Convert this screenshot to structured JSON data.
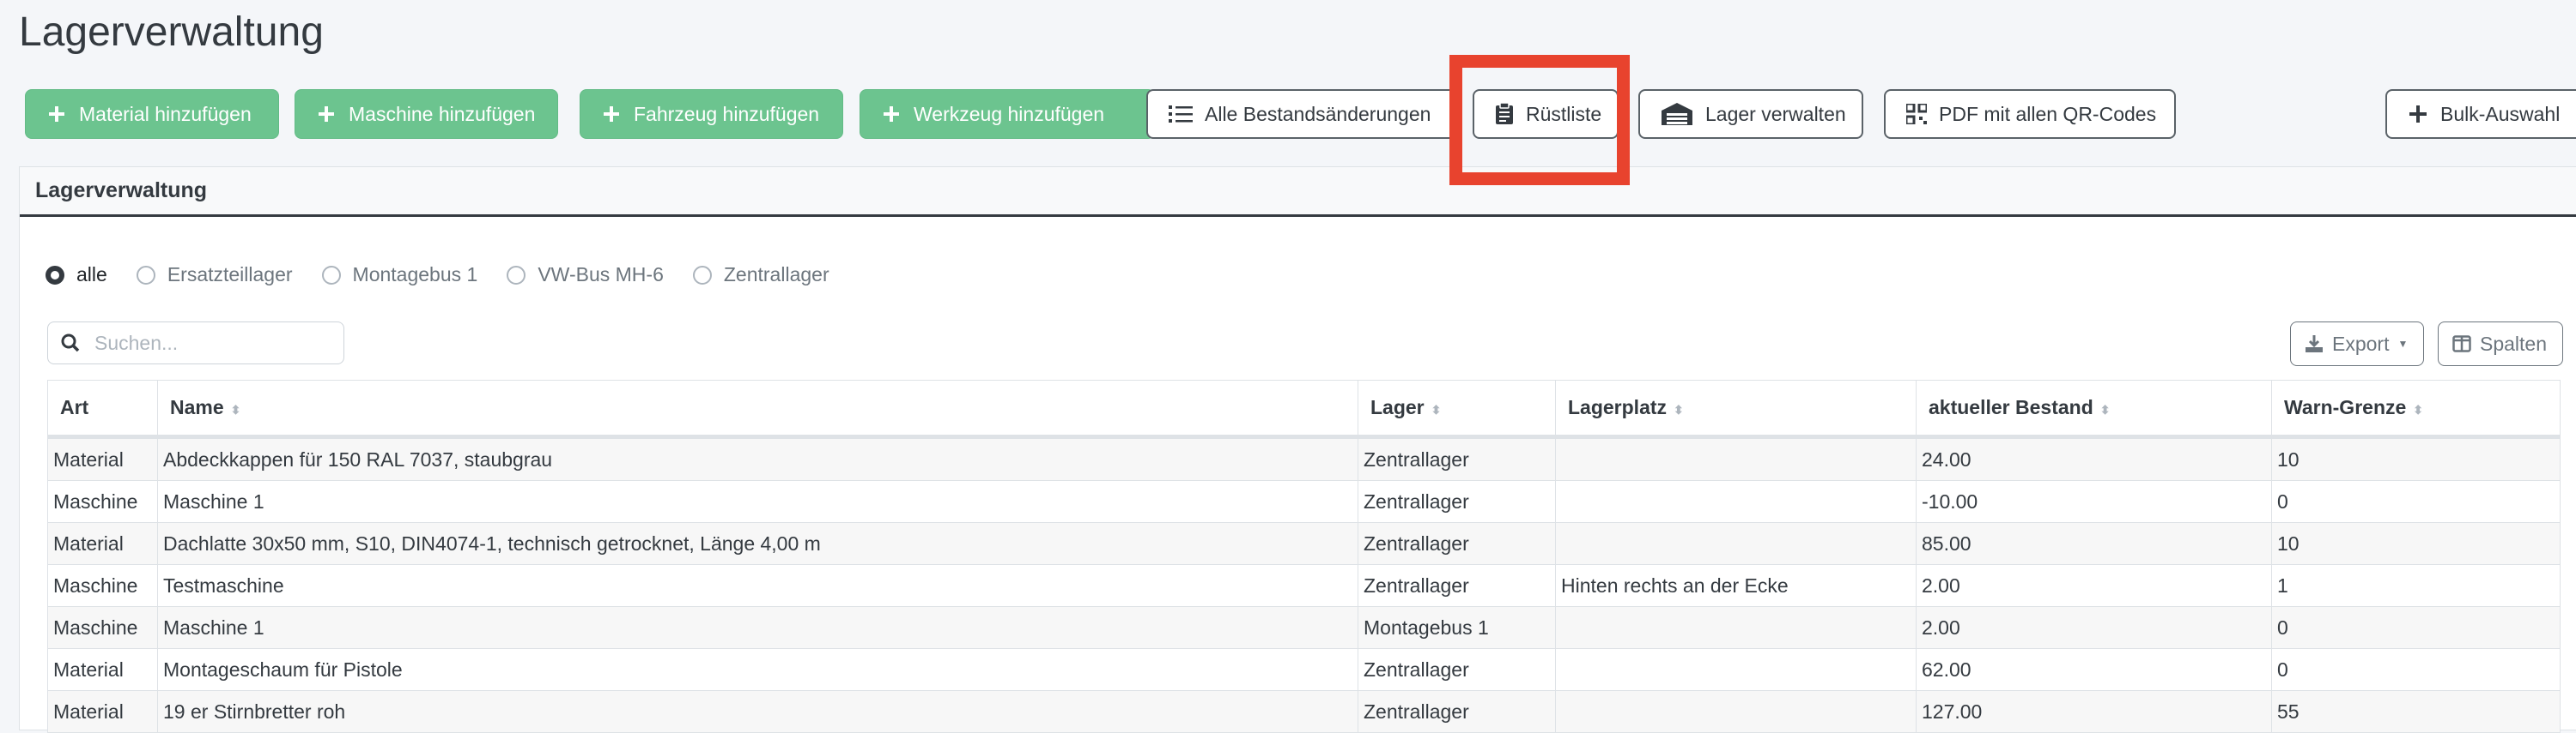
{
  "page": {
    "title": "Lagerverwaltung"
  },
  "toolbar": {
    "add_material": "Material hinzufügen",
    "add_machine": "Maschine hinzufügen",
    "add_vehicle": "Fahrzeug hinzufügen",
    "add_tool": "Werkzeug hinzufügen",
    "all_changes": "Alle Bestandsänderungen",
    "ruestliste": "Rüstliste",
    "manage_storage": "Lager verwalten",
    "pdf_qr": "PDF mit allen QR-Codes",
    "bulk": "Bulk-Auswahl"
  },
  "card": {
    "title": "Lagerverwaltung"
  },
  "filters": [
    "alle",
    "Ersatzteillager",
    "Montagebus 1",
    "VW-Bus MH-6",
    "Zentrallager"
  ],
  "filters_selected": "alle",
  "search": {
    "placeholder": "Suchen..."
  },
  "table_tools": {
    "export": "Export",
    "columns": "Spalten"
  },
  "table": {
    "columns": [
      "Art",
      "Name",
      "Lager",
      "Lagerplatz",
      "aktueller Bestand",
      "Warn-Grenze"
    ],
    "rows": [
      [
        "Material",
        "Abdeckkappen für 150 RAL 7037, staubgrau",
        "Zentrallager",
        "",
        "24.00",
        "10"
      ],
      [
        "Maschine",
        "Maschine 1",
        "Zentrallager",
        "",
        "-10.00",
        "0"
      ],
      [
        "Material",
        "Dachlatte 30x50 mm, S10, DIN4074-1, technisch getrocknet, Länge 4,00 m",
        "Zentrallager",
        "",
        "85.00",
        "10"
      ],
      [
        "Maschine",
        "Testmaschine",
        "Zentrallager",
        "Hinten rechts an der Ecke",
        "2.00",
        "1"
      ],
      [
        "Maschine",
        "Maschine 1",
        "Montagebus 1",
        "",
        "2.00",
        "0"
      ],
      [
        "Material",
        "Montageschaum für Pistole",
        "Zentrallager",
        "",
        "62.00",
        "0"
      ],
      [
        "Material",
        "19 er Stirnbretter roh",
        "Zentrallager",
        "",
        "127.00",
        "55"
      ]
    ]
  },
  "colors": {
    "success": "#6cc48f",
    "highlight": "#e8432e",
    "header_border": "#343a40"
  }
}
